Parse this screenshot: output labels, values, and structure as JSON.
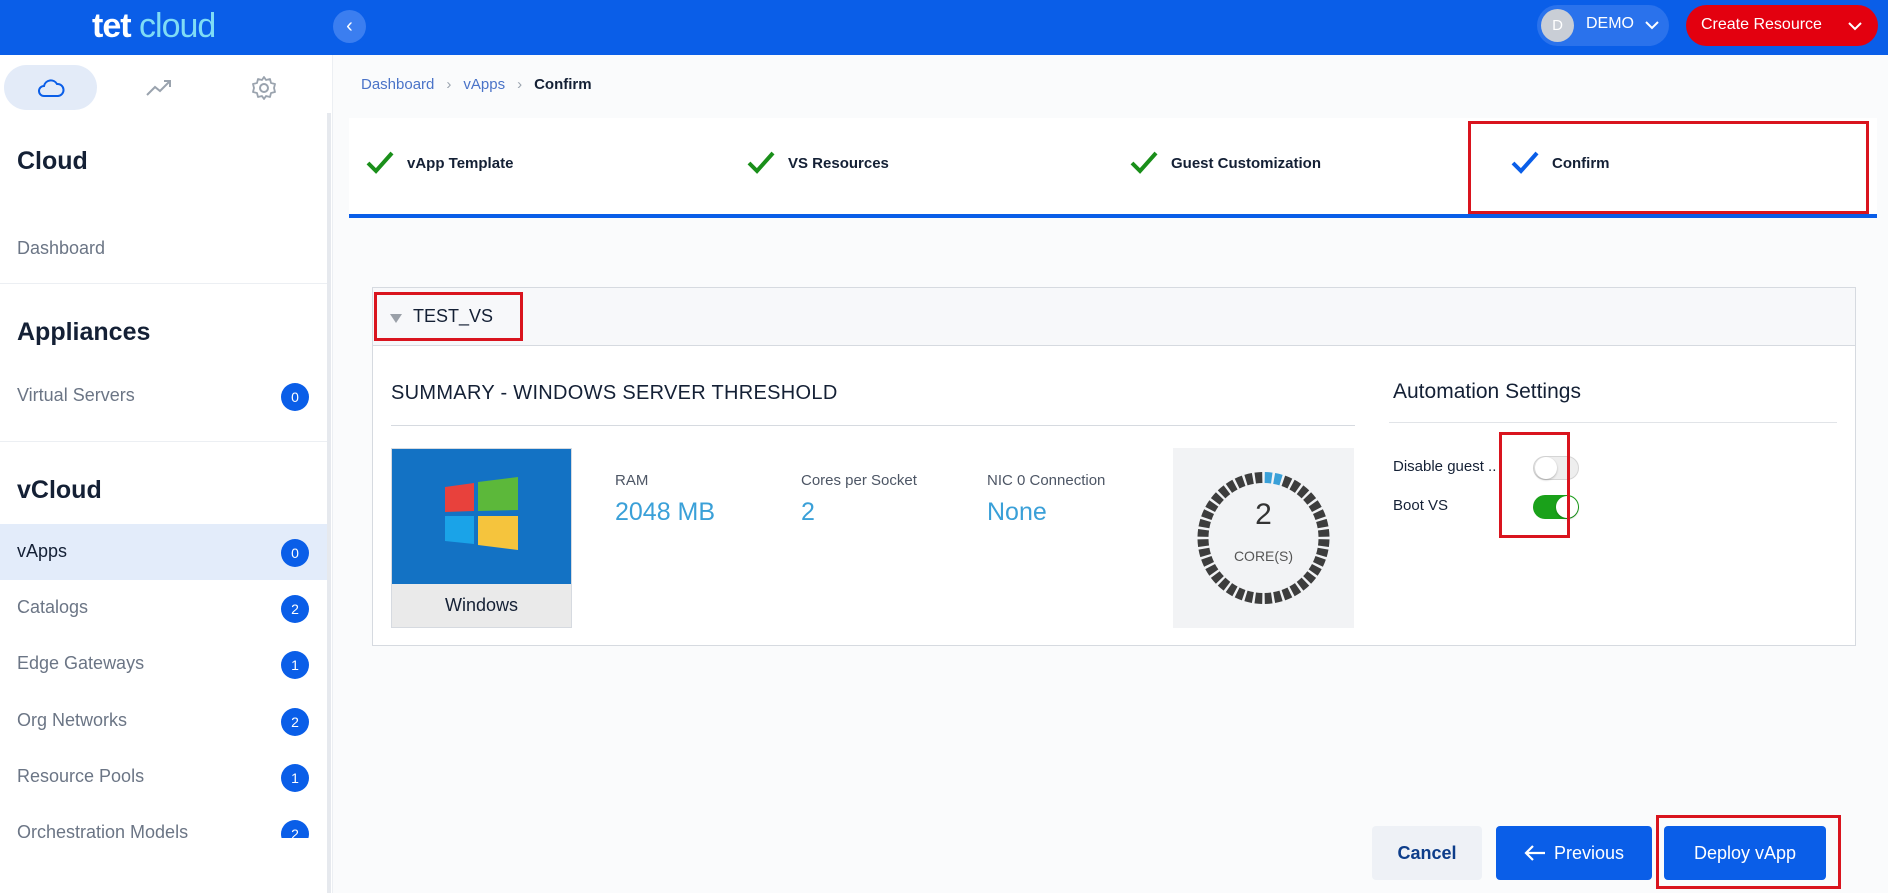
{
  "app": {
    "logo_part1": "tet",
    "logo_part2": "cloud"
  },
  "header": {
    "user_initial": "D",
    "user_name": "DEMO",
    "create_label": "Create Resource"
  },
  "sidebar": {
    "sections": [
      {
        "title": "Cloud"
      },
      {
        "title": "Appliances"
      },
      {
        "title": "vCloud"
      }
    ],
    "items": [
      {
        "label": "Dashboard"
      },
      {
        "label": "Virtual Servers",
        "badge": "0"
      },
      {
        "label": "vApps",
        "badge": "0"
      },
      {
        "label": "Catalogs",
        "badge": "2"
      },
      {
        "label": "Edge Gateways",
        "badge": "1"
      },
      {
        "label": "Org Networks",
        "badge": "2"
      },
      {
        "label": "Resource Pools",
        "badge": "1"
      },
      {
        "label": "Orchestration Models",
        "badge": "2"
      }
    ]
  },
  "breadcrumb": {
    "items": [
      "Dashboard",
      "vApps"
    ],
    "current": "Confirm"
  },
  "stepper": {
    "steps": [
      {
        "label": "vApp Template",
        "status": "complete"
      },
      {
        "label": "VS Resources",
        "status": "complete"
      },
      {
        "label": "Guest Customization",
        "status": "complete"
      },
      {
        "label": "Confirm",
        "status": "current"
      }
    ]
  },
  "vs": {
    "name": "TEST_VS",
    "summary_title": "SUMMARY - WINDOWS SERVER THRESHOLD",
    "os_name": "Windows",
    "specs": [
      {
        "label": "RAM",
        "value": "2048 MB"
      },
      {
        "label": "Cores per Socket",
        "value": "2"
      },
      {
        "label": "NIC 0 Connection",
        "value": "None"
      }
    ],
    "cores": {
      "value": "2",
      "label": "CORE(S)"
    }
  },
  "automation": {
    "title": "Automation Settings",
    "settings": [
      {
        "label": "Disable guest ..",
        "enabled": false
      },
      {
        "label": "Boot VS",
        "enabled": true
      }
    ]
  },
  "footer": {
    "cancel_label": "Cancel",
    "previous_label": "Previous",
    "deploy_label": "Deploy vApp"
  },
  "colors": {
    "primary": "#0a5ee8",
    "danger": "#e3000f",
    "success": "#1aa11a",
    "accent_value": "#3aa0d8"
  }
}
